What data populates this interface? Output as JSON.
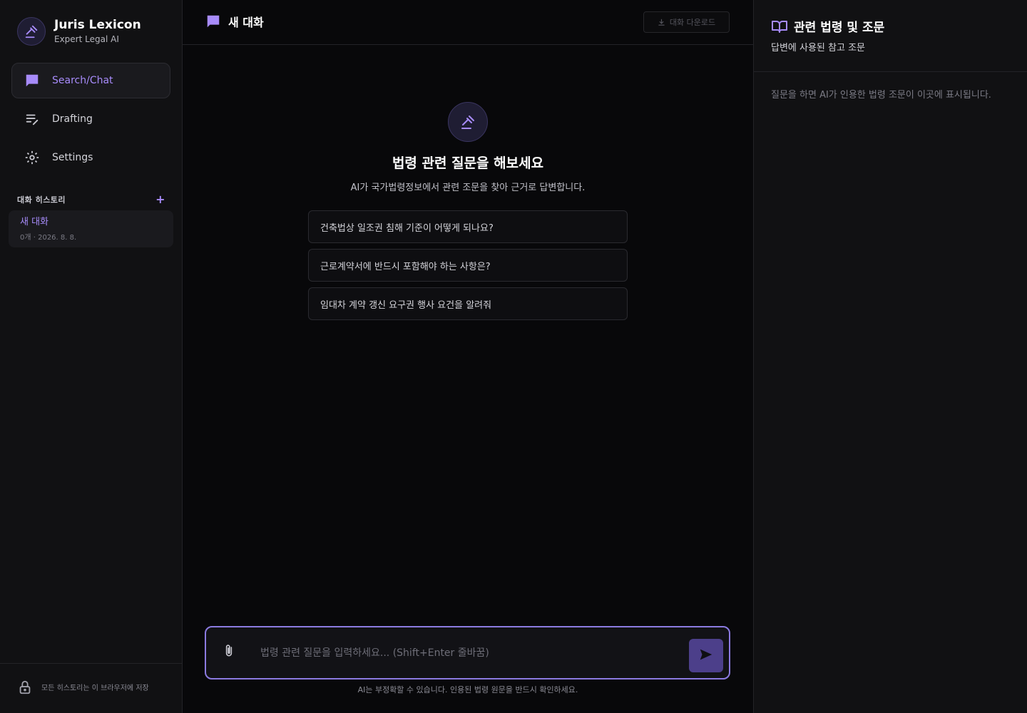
{
  "brand": {
    "name": "Juris Lexicon",
    "subtitle": "Expert Legal AI"
  },
  "nav": {
    "items": [
      {
        "label": "Search/Chat",
        "icon": "chat-icon",
        "active": true
      },
      {
        "label": "Drafting",
        "icon": "drafting-icon",
        "active": false
      },
      {
        "label": "Settings",
        "icon": "gear-icon",
        "active": false
      }
    ]
  },
  "history": {
    "title": "대화 히스토리",
    "add_label": "+",
    "items": [
      {
        "title": "새 대화",
        "meta": "0개 · 2026. 8. 8."
      }
    ]
  },
  "sidebar_footer": {
    "text": "모든 히스토리는 이 브라우저에 저장"
  },
  "chat": {
    "title": "새 대화",
    "download_label": "대화 다운로드",
    "hero_title": "법령 관련 질문을 해보세요",
    "hero_subtitle": "AI가 국가법령정보에서 관련 조문을 찾아 근거로 답변합니다.",
    "suggestions": [
      "건축법상 일조권 침해 기준이 어떻게 되나요?",
      "근로계약서에 반드시 포함해야 하는 사항은?",
      "임대차 계약 갱신 요구권 행사 요건을 알려줘"
    ],
    "input_placeholder": "법령 관련 질문을 입력하세요... (Shift+Enter 줄바꿈)",
    "disclaimer": "AI는 부정확할 수 있습니다. 인용된 법령 원문을 반드시 확인하세요."
  },
  "references": {
    "title": "관련 법령 및 조문",
    "subtitle": "답변에 사용된 참고 조문",
    "empty_text": "질문을 하면 AI가 인용한 법령 조문이 이곳에 표시됩니다."
  },
  "colors": {
    "accent": "#a78bfa",
    "background": "#08080a",
    "panel": "#111113",
    "send": "#4c3f8a"
  }
}
